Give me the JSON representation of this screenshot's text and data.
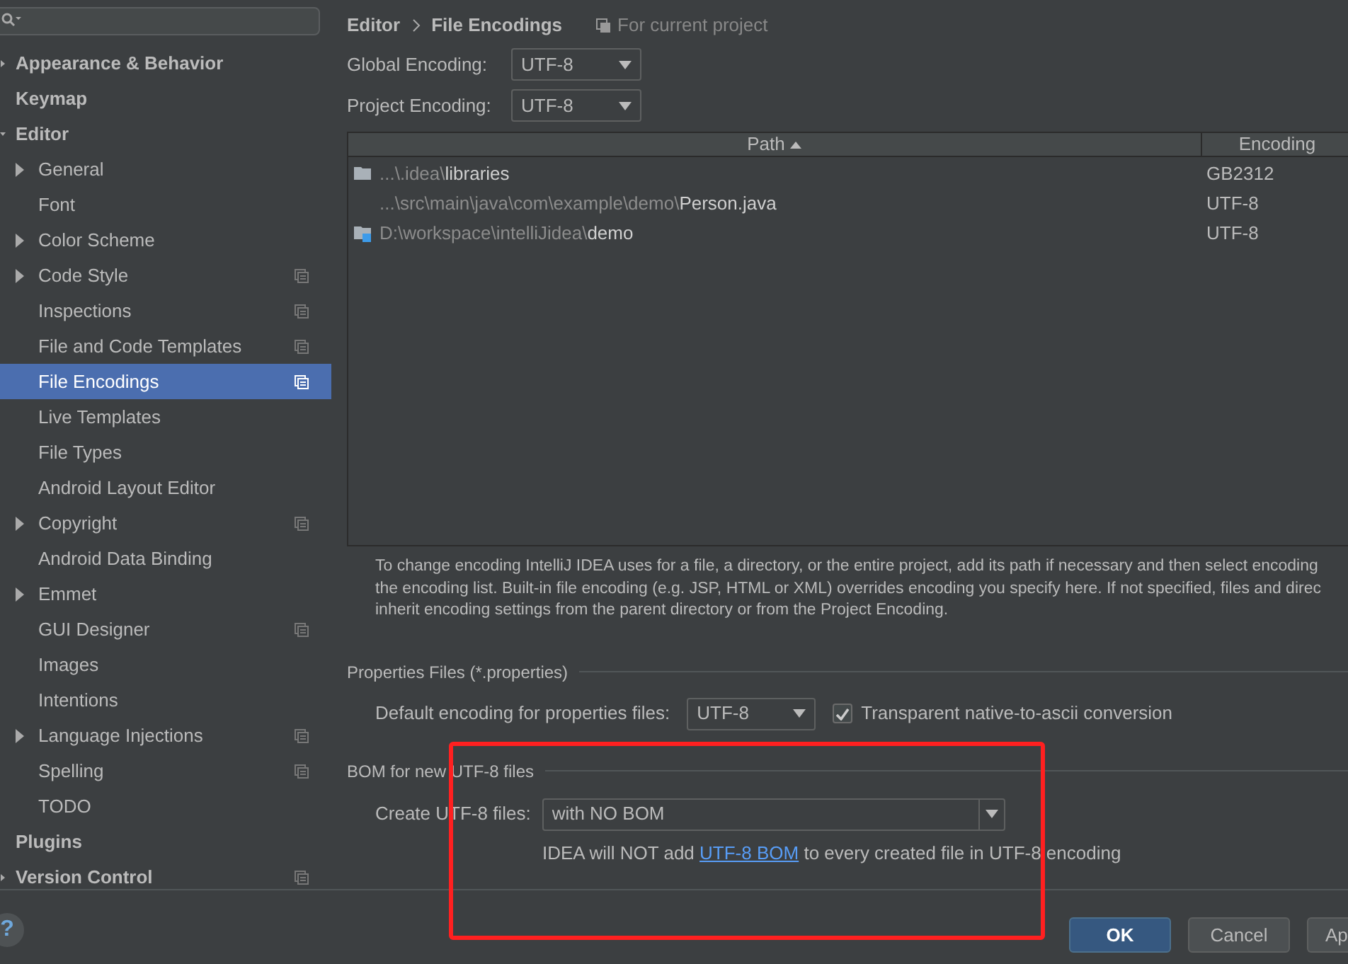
{
  "sidebar": {
    "items": [
      {
        "label": "Appearance & Behavior",
        "expanded": false,
        "selected": false,
        "project_scope": false
      },
      {
        "label": "Keymap",
        "selected": false,
        "project_scope": false
      },
      {
        "label": "Editor",
        "expanded": true,
        "selected": false,
        "project_scope": false,
        "children": [
          {
            "label": "General",
            "expanded": false,
            "selected": false,
            "project_scope": false
          },
          {
            "label": "Font",
            "selected": false,
            "project_scope": false
          },
          {
            "label": "Color Scheme",
            "expanded": false,
            "selected": false,
            "project_scope": false
          },
          {
            "label": "Code Style",
            "expanded": false,
            "selected": false,
            "project_scope": true
          },
          {
            "label": "Inspections",
            "selected": false,
            "project_scope": true
          },
          {
            "label": "File and Code Templates",
            "selected": false,
            "project_scope": true
          },
          {
            "label": "File Encodings",
            "selected": true,
            "project_scope": true
          },
          {
            "label": "Live Templates",
            "selected": false,
            "project_scope": false
          },
          {
            "label": "File Types",
            "selected": false,
            "project_scope": false
          },
          {
            "label": "Android Layout Editor",
            "selected": false,
            "project_scope": false
          },
          {
            "label": "Copyright",
            "expanded": false,
            "selected": false,
            "project_scope": true
          },
          {
            "label": "Android Data Binding",
            "selected": false,
            "project_scope": false
          },
          {
            "label": "Emmet",
            "expanded": false,
            "selected": false,
            "project_scope": false
          },
          {
            "label": "GUI Designer",
            "selected": false,
            "project_scope": true
          },
          {
            "label": "Images",
            "selected": false,
            "project_scope": false
          },
          {
            "label": "Intentions",
            "selected": false,
            "project_scope": false
          },
          {
            "label": "Language Injections",
            "expanded": false,
            "selected": false,
            "project_scope": true
          },
          {
            "label": "Spelling",
            "selected": false,
            "project_scope": true
          },
          {
            "label": "TODO",
            "selected": false,
            "project_scope": false
          }
        ]
      },
      {
        "label": "Plugins",
        "selected": false,
        "project_scope": false
      },
      {
        "label": "Version Control",
        "expanded": false,
        "selected": false,
        "project_scope": true
      }
    ]
  },
  "breadcrumb": [
    "Editor",
    "File Encodings"
  ],
  "scope_note": "For current project",
  "encoding_fields": [
    {
      "label": "Global Encoding:",
      "value": "UTF-8"
    },
    {
      "label": "Project Encoding:",
      "value": "UTF-8"
    }
  ],
  "table": {
    "columns": [
      {
        "label": "Path",
        "sorted": true
      },
      {
        "label": "Encoding",
        "sorted": false
      }
    ],
    "rows": [
      {
        "kind": "folder",
        "path": [
          {
            "text": "...\\.idea\\",
            "dim": true
          },
          {
            "text": "libraries",
            "dim": false
          }
        ],
        "encoding": "GB2312"
      },
      {
        "kind": "file",
        "path": [
          {
            "text": "...\\src\\main\\java\\com\\example\\demo\\",
            "dim": true
          },
          {
            "text": "Person.java",
            "dim": false
          }
        ],
        "encoding": "UTF-8"
      },
      {
        "kind": "module",
        "path": [
          {
            "text": "D:\\workspace\\intelliJidea\\",
            "dim": true
          },
          {
            "text": "demo",
            "dim": false
          }
        ],
        "encoding": "UTF-8"
      }
    ]
  },
  "description": [
    "To change encoding IntelliJ IDEA uses for a file, a directory, or the entire project, add its path if necessary and then select encoding",
    "the encoding list. Built-in file encoding (e.g. JSP, HTML or XML) overrides encoding you specify here. If not specified, files and direc",
    "inherit encoding settings from the parent directory or from the Project Encoding."
  ],
  "properties_section": {
    "title": "Properties Files (*.properties)",
    "label": "Default encoding for properties files:",
    "value": "UTF-8",
    "checkbox": {
      "label": "Transparent native-to-ascii conversion",
      "checked": true
    }
  },
  "bom_section": {
    "title": "BOM for new UTF-8 files",
    "label": "Create UTF-8 files:",
    "value": "with NO BOM",
    "info_before": "IDEA will NOT add ",
    "info_link": "UTF-8 BOM",
    "info_after": " to every created file in UTF-8 encoding"
  },
  "help_button": "?",
  "buttons": [
    {
      "label": "OK",
      "kind": "primary"
    },
    {
      "label": "Cancel",
      "kind": "normal"
    },
    {
      "label": "Ap",
      "kind": "normal"
    }
  ]
}
